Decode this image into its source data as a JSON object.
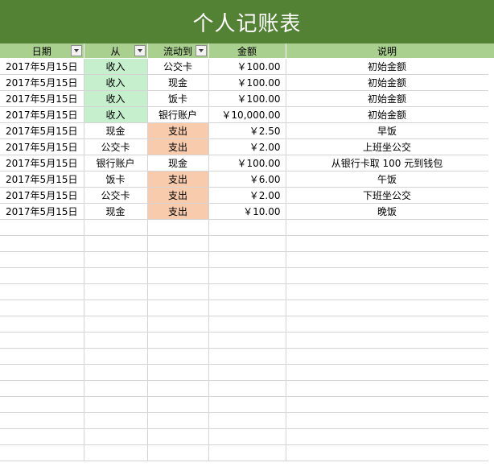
{
  "title": "个人记账表",
  "headers": {
    "date": "日期",
    "from": "从",
    "to": "流动到",
    "amount": "金额",
    "note": "说明"
  },
  "rows": [
    {
      "date": "2017年5月15日",
      "from": "收入",
      "to": "公交卡",
      "amount": "￥100.00",
      "note": "初始金额"
    },
    {
      "date": "2017年5月15日",
      "from": "收入",
      "to": "现金",
      "amount": "￥100.00",
      "note": "初始金额"
    },
    {
      "date": "2017年5月15日",
      "from": "收入",
      "to": "饭卡",
      "amount": "￥100.00",
      "note": "初始金额"
    },
    {
      "date": "2017年5月15日",
      "from": "收入",
      "to": "银行账户",
      "amount": "￥10,000.00",
      "note": "初始金额"
    },
    {
      "date": "2017年5月15日",
      "from": "现金",
      "to": "支出",
      "amount": "￥2.50",
      "note": "早饭"
    },
    {
      "date": "2017年5月15日",
      "from": "公交卡",
      "to": "支出",
      "amount": "￥2.00",
      "note": "上班坐公交"
    },
    {
      "date": "2017年5月15日",
      "from": "银行账户",
      "to": "现金",
      "amount": "￥100.00",
      "note": "从银行卡取 100 元到钱包"
    },
    {
      "date": "2017年5月15日",
      "from": "饭卡",
      "to": "支出",
      "amount": "￥6.00",
      "note": "午饭"
    },
    {
      "date": "2017年5月15日",
      "from": "公交卡",
      "to": "支出",
      "amount": "￥2.00",
      "note": "下班坐公交"
    },
    {
      "date": "2017年5月15日",
      "from": "现金",
      "to": "支出",
      "amount": "￥10.00",
      "note": "晚饭"
    }
  ],
  "colors": {
    "title_bg": "#548235",
    "header_bg": "#a9d08e",
    "income_bg": "#c6efce",
    "expense_bg": "#f8cbad"
  }
}
